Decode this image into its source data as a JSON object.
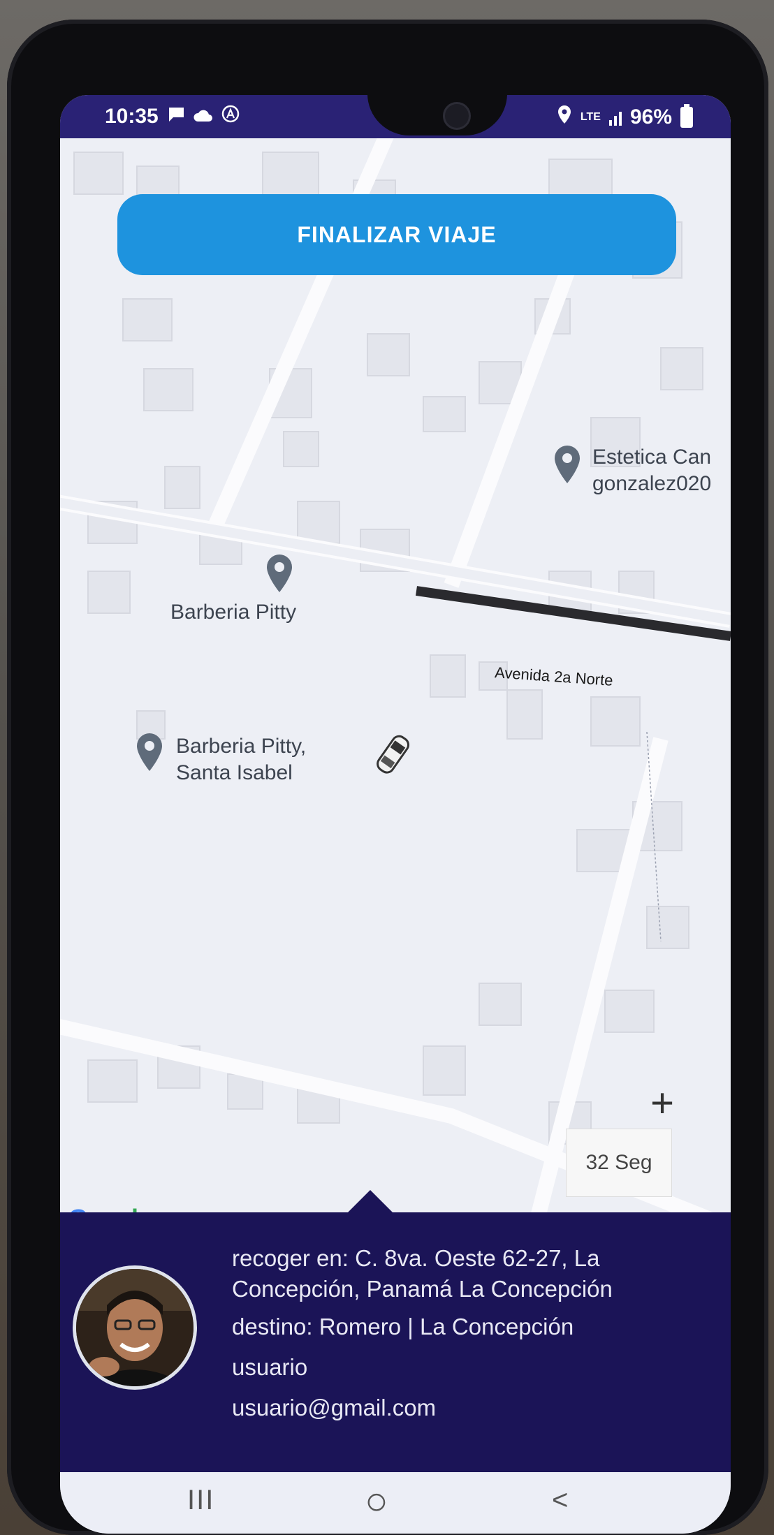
{
  "status_bar": {
    "time": "10:35",
    "network": "LTE",
    "battery": "96%"
  },
  "map": {
    "finalizar_label": "FINALIZAR VIAJE",
    "pois": [
      {
        "line1": "Estetica Can",
        "line2": "gonzalez020"
      },
      {
        "line1": "Barberia Pitty",
        "line2": ""
      },
      {
        "line1": "Barberia Pitty,",
        "line2": "Santa Isabel"
      }
    ],
    "street": "Avenida 2a Norte",
    "zoom_in": "+",
    "timer": "32 Seg",
    "attribution": "Google"
  },
  "trip": {
    "pickup": "recoger en: C. 8va. Oeste 62-27, La Concepción, Panamá La Concepción",
    "destination": "destino: Romero | La Concepción",
    "user_name": "usuario",
    "user_email": "usuario@gmail.com"
  },
  "colors": {
    "accent": "#1e93de",
    "panel": "#1b1457",
    "status_bar": "#2a2275"
  },
  "nav": {
    "recents": "III",
    "home": "○",
    "back": "<"
  }
}
